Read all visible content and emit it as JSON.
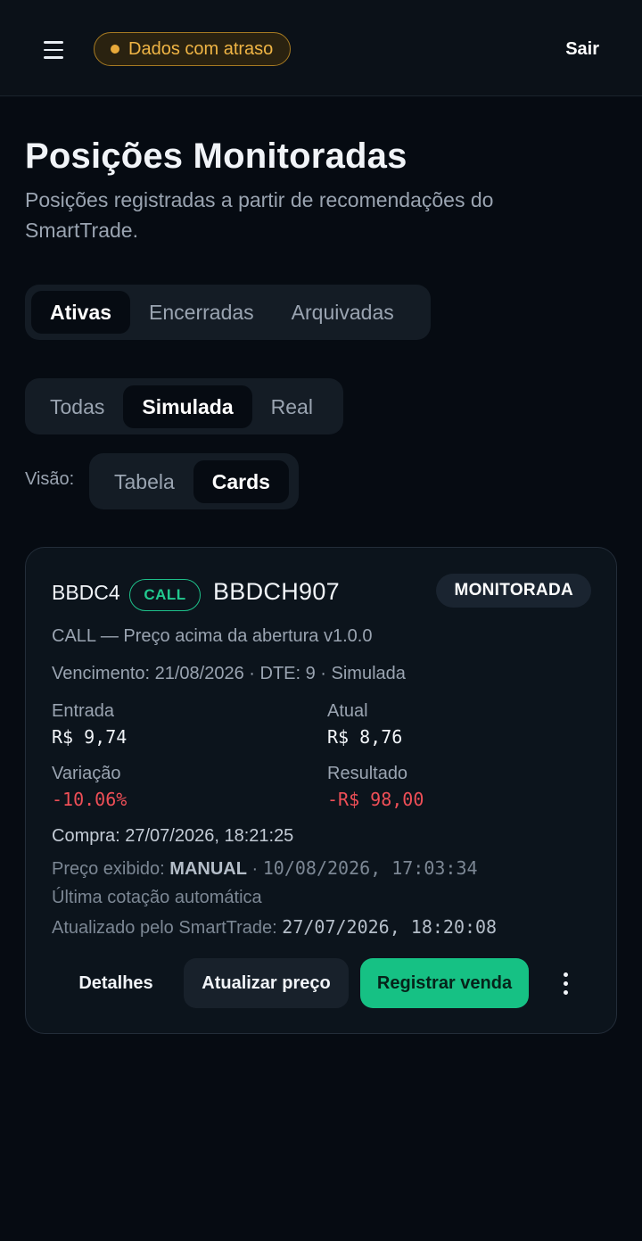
{
  "header": {
    "menu_icon": "hamburger-menu-icon",
    "delay_badge": "Dados com atraso",
    "logout_label": "Sair"
  },
  "page": {
    "title": "Posições Monitoradas",
    "subtitle": "Posições registradas a partir de recomendações do SmartTrade."
  },
  "status_tabs": [
    {
      "label": "Ativas",
      "active": true
    },
    {
      "label": "Encerradas",
      "active": false
    },
    {
      "label": "Arquivadas",
      "active": false
    }
  ],
  "mode_tabs": [
    {
      "label": "Todas",
      "active": false
    },
    {
      "label": "Simulada",
      "active": true
    },
    {
      "label": "Real",
      "active": false
    }
  ],
  "view": {
    "label": "Visão:",
    "options": [
      {
        "label": "Tabela",
        "active": false
      },
      {
        "label": "Cards",
        "active": true
      }
    ]
  },
  "position_card": {
    "ticker": "BBDC4",
    "type_badge": "CALL",
    "option_code": "BBDCH907",
    "status": "MONITORADA",
    "strategy": "CALL — Preço acima da abertura v1.0.0",
    "expiry_line": "Vencimento: 21/08/2026 · DTE: 9 · Simulada",
    "entry_label": "Entrada",
    "entry_value": "R$ 9,74",
    "current_label": "Atual",
    "current_value": "R$ 8,76",
    "variation_label": "Variação",
    "variation_value": "-10.06%",
    "result_label": "Resultado",
    "result_value": "-R$ 98,00",
    "purchase_line": "Compra: 27/07/2026, 18:21:25",
    "shown_price_prefix": "Preço exibido: ",
    "shown_price_source": "MANUAL",
    "shown_price_sep": " · ",
    "shown_price_time": "10/08/2026, 17:03:34",
    "last_quote": "Última cotação automática",
    "updated_prefix": "Atualizado pelo SmartTrade: ",
    "updated_time": "27/07/2026, 18:20:08",
    "actions": {
      "details": "Detalhes",
      "update_price": "Atualizar preço",
      "register_sale": "Registrar venda",
      "more_icon": "more-vertical-icon"
    }
  },
  "colors": {
    "background": "#060b12",
    "accent_green": "#16c184",
    "negative_red": "#ef4f57",
    "warning_amber": "#f0b545"
  }
}
